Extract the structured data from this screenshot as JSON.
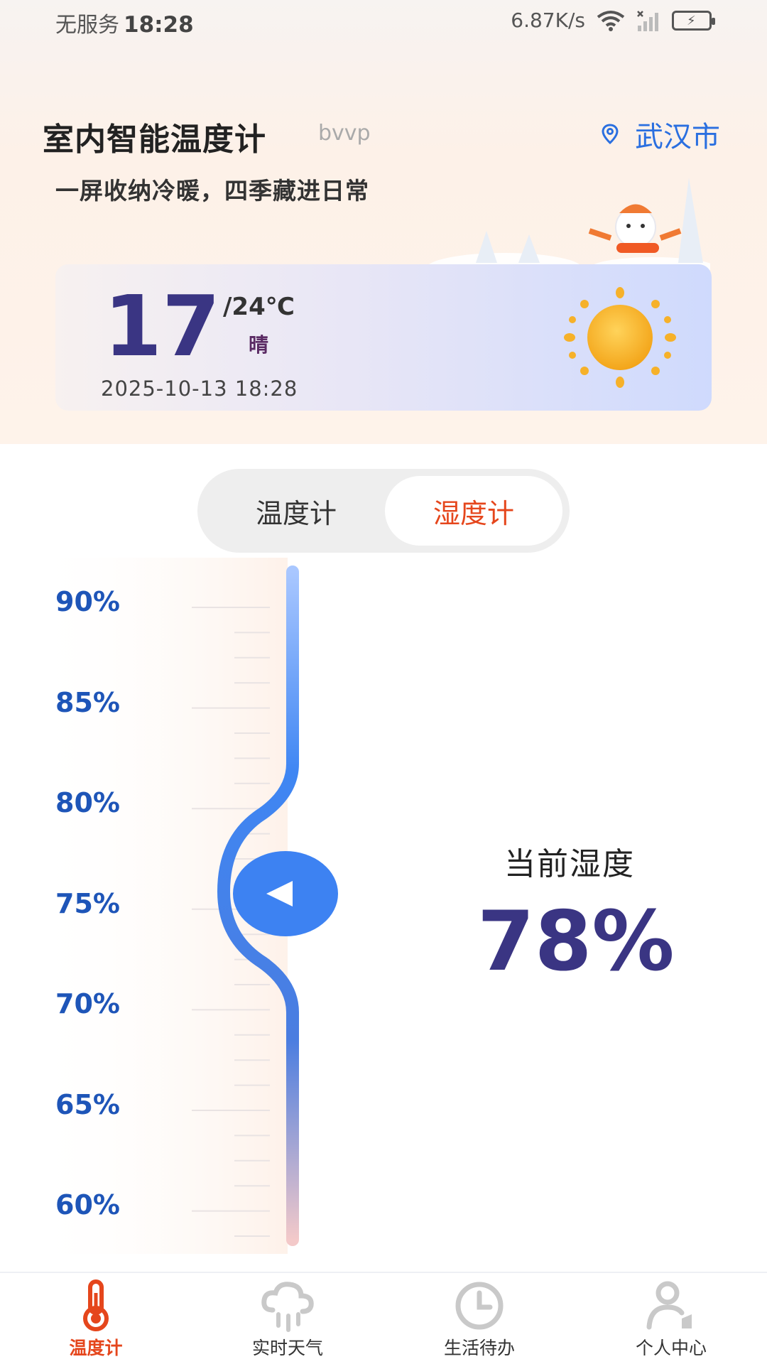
{
  "status_bar": {
    "carrier": "无服务",
    "time": "18:28",
    "speed": "6.87K/s"
  },
  "header": {
    "title": "室内智能温度计",
    "subtitle": "bvvp",
    "location": "武汉市",
    "tagline": "一屏收纳冷暖，四季藏进日常"
  },
  "weather": {
    "temp": "17",
    "high": "/24℃",
    "condition": "晴",
    "datetime": "2025-10-13 18:28"
  },
  "segment": {
    "tab1": "温度计",
    "tab2": "湿度计",
    "active": "tab2"
  },
  "gauge": {
    "labels": [
      "90%",
      "85%",
      "80%",
      "75%",
      "70%",
      "65%",
      "60%"
    ],
    "current_level": 78
  },
  "current": {
    "label": "当前湿度",
    "value": "78%"
  },
  "tabbar": {
    "items": [
      "温度计",
      "实时天气",
      "生活待办",
      "个人中心"
    ],
    "active": 0
  },
  "colors": {
    "accent": "#e5461c",
    "primary": "#3a3583",
    "blue": "#2a6fe0"
  }
}
